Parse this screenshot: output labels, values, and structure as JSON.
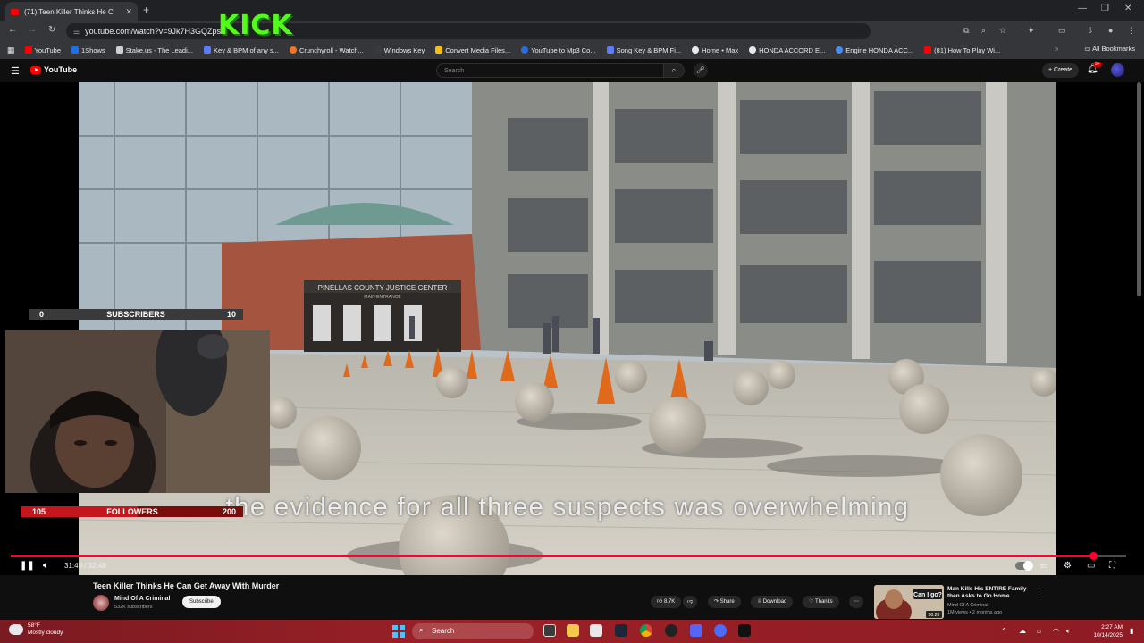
{
  "browser": {
    "tab_title": "(71) Teen Killer Thinks He C",
    "new_tab": "+",
    "url": "youtube.com/watch?v=9Jk7H3GQZps",
    "bookmarks": [
      "YouTube",
      "1Shows",
      "Stake.us - The Leadi...",
      "Key & BPM of any s...",
      "Crunchyroll - Watch...",
      "Windows Key",
      "Convert Media Files...",
      "YouTube to Mp3 Co...",
      "Song Key & BPM Fi...",
      "Home • Max",
      "HONDA ACCORD E...",
      "Engine HONDA ACC...",
      "(81) How To Play Wi..."
    ],
    "all_bookmarks": "All Bookmarks"
  },
  "overlay": {
    "kick_logo": "KICK",
    "subscribers": {
      "label": "SUBSCRIBERS",
      "current": "0",
      "goal": "10",
      "progress": 0.0
    },
    "followers": {
      "label": "FOLLOWERS",
      "current": "105",
      "goal": "200",
      "progress": 0.525
    }
  },
  "youtube": {
    "logo_text": "YouTube",
    "search_placeholder": "Search",
    "create_label": "+ Create",
    "notif_count": "9+"
  },
  "video": {
    "building_sign": "PINELLAS COUNTY JUSTICE CENTER",
    "building_sign_sub": "MAIN ENTRANCE",
    "caption": "the evidence for all three suspects was overwhelming",
    "time": "31:49 / 32:48",
    "progress": 0.97,
    "title": "Teen Killer Thinks He Can Get Away With Murder",
    "channel": "Mind Of A Criminal",
    "subscribers": "532K subscribers",
    "subscribe_label": "Subscribe",
    "likes": "8.7K",
    "share_label": "Share",
    "download_label": "Download",
    "thanks_label": "Thanks"
  },
  "recommended": {
    "thumb_text": "Can I go?",
    "duration": "30:28",
    "title": "Man Kills His ENTIRE Family then Asks to Go Home",
    "channel": "Mind Of A Criminal",
    "meta": "1M views • 2 months ago"
  },
  "taskbar": {
    "temp": "58°F",
    "condition": "Mostly cloudy",
    "search_label": "Search",
    "time": "2:27 AM",
    "date": "10/14/2025"
  },
  "colors": {
    "kick_green": "#53fc18",
    "yt_red": "#ff0000",
    "progress_red": "#ff0033",
    "followers_red": "#c4161c"
  }
}
